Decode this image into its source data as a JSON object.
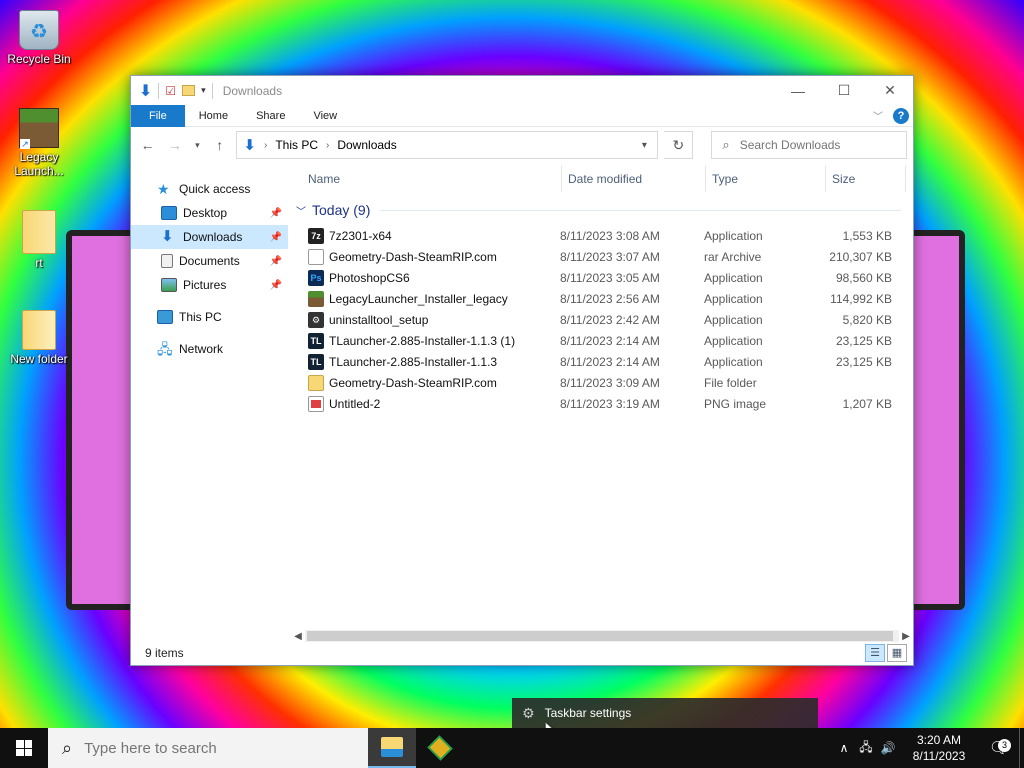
{
  "desktop": {
    "icons": [
      {
        "label": "Recycle Bin"
      },
      {
        "label": "Legacy Launch..."
      },
      {
        "label": "rt"
      },
      {
        "label": "New folder"
      }
    ]
  },
  "window": {
    "title": "Downloads",
    "controls": {
      "minimize": "—",
      "maximize": "☐",
      "close": "✕"
    },
    "ribbon": {
      "file": "File",
      "home": "Home",
      "share": "Share",
      "view": "View",
      "help": "?"
    },
    "address": {
      "segments": [
        "This PC",
        "Downloads"
      ]
    },
    "search": {
      "placeholder": "Search Downloads"
    },
    "sidebar": {
      "items": [
        {
          "label": "Quick access"
        },
        {
          "label": "Desktop"
        },
        {
          "label": "Downloads"
        },
        {
          "label": "Documents"
        },
        {
          "label": "Pictures"
        },
        {
          "label": "This PC"
        },
        {
          "label": "Network"
        }
      ]
    },
    "columns": {
      "name": "Name",
      "date": "Date modified",
      "type": "Type",
      "size": "Size"
    },
    "group": {
      "label": "Today (9)"
    },
    "files": [
      {
        "name": "7z2301-x64",
        "date": "8/11/2023 3:08 AM",
        "type": "Application",
        "size": "1,553 KB",
        "icon": "7z-icon"
      },
      {
        "name": "Geometry-Dash-SteamRIP.com",
        "date": "8/11/2023 3:07 AM",
        "type": "rar Archive",
        "size": "210,307 KB",
        "icon": "archive-icon"
      },
      {
        "name": "PhotoshopCS6",
        "date": "8/11/2023 3:05 AM",
        "type": "Application",
        "size": "98,560 KB",
        "icon": "photoshop-icon"
      },
      {
        "name": "LegacyLauncher_Installer_legacy",
        "date": "8/11/2023 2:56 AM",
        "type": "Application",
        "size": "114,992 KB",
        "icon": "minecraft-icon"
      },
      {
        "name": "uninstalltool_setup",
        "date": "8/11/2023 2:42 AM",
        "type": "Application",
        "size": "5,820 KB",
        "icon": "installer-icon"
      },
      {
        "name": "TLauncher-2.885-Installer-1.1.3 (1)",
        "date": "8/11/2023 2:14 AM",
        "type": "Application",
        "size": "23,125 KB",
        "icon": "tlauncher-icon"
      },
      {
        "name": "TLauncher-2.885-Installer-1.1.3",
        "date": "8/11/2023 2:14 AM",
        "type": "Application",
        "size": "23,125 KB",
        "icon": "tlauncher-icon"
      },
      {
        "name": "Geometry-Dash-SteamRIP.com",
        "date": "8/11/2023 3:09 AM",
        "type": "File folder",
        "size": "",
        "icon": "folder-icon"
      },
      {
        "name": "Untitled-2",
        "date": "8/11/2023 3:19 AM",
        "type": "PNG image",
        "size": "1,207 KB",
        "icon": "png-icon"
      }
    ],
    "status": {
      "count": "9 items"
    }
  },
  "context_menu": {
    "item": "Taskbar settings"
  },
  "taskbar": {
    "search_placeholder": "Type here to search",
    "clock": {
      "time": "3:20 AM",
      "date": "8/11/2023"
    },
    "notifications": "3"
  }
}
